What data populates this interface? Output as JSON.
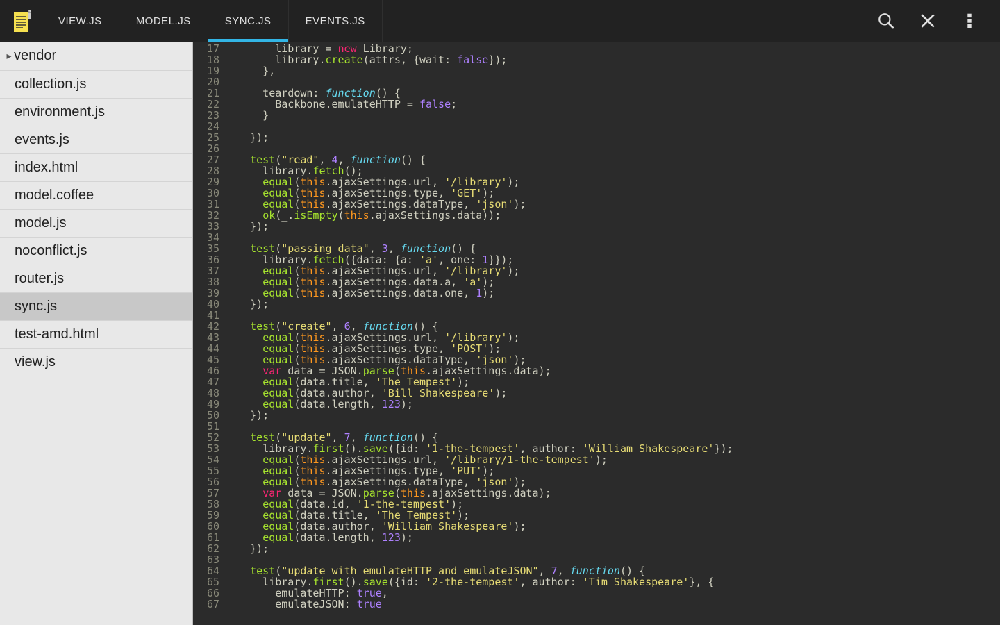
{
  "tabs": [
    {
      "label": "VIEW.JS",
      "active": false
    },
    {
      "label": "MODEL.JS",
      "active": false
    },
    {
      "label": "SYNC.JS",
      "active": true
    },
    {
      "label": "EVENTS.JS",
      "active": false
    }
  ],
  "sidebar": {
    "folder": "vendor",
    "files": [
      {
        "name": "collection.js",
        "selected": false
      },
      {
        "name": "environment.js",
        "selected": false
      },
      {
        "name": "events.js",
        "selected": false
      },
      {
        "name": "index.html",
        "selected": false
      },
      {
        "name": "model.coffee",
        "selected": false
      },
      {
        "name": "model.js",
        "selected": false
      },
      {
        "name": "noconflict.js",
        "selected": false
      },
      {
        "name": "router.js",
        "selected": false
      },
      {
        "name": "sync.js",
        "selected": true
      },
      {
        "name": "test-amd.html",
        "selected": false
      },
      {
        "name": "view.js",
        "selected": false
      }
    ]
  },
  "editor": {
    "firstLine": 17,
    "lines": [
      {
        "t": "        library = ",
        "s": [
          {
            "c": "tk-kw",
            "t": "new"
          },
          {
            "t": " Library;"
          }
        ]
      },
      {
        "t": "        library.",
        "s": [
          {
            "c": "tk-call",
            "t": "create"
          },
          {
            "t": "(attrs, {wait: "
          },
          {
            "c": "tk-bool",
            "t": "false"
          },
          {
            "t": "});"
          }
        ]
      },
      {
        "t": "      },"
      },
      {
        "t": ""
      },
      {
        "t": "      teardown: ",
        "s": [
          {
            "c": "tk-fn",
            "t": "function"
          },
          {
            "t": "() {"
          }
        ]
      },
      {
        "t": "        Backbone.emulateHTTP = ",
        "s": [
          {
            "c": "tk-bool",
            "t": "false"
          },
          {
            "t": ";"
          }
        ]
      },
      {
        "t": "      }"
      },
      {
        "t": ""
      },
      {
        "t": "    });"
      },
      {
        "t": ""
      },
      {
        "t": "    ",
        "s": [
          {
            "c": "tk-call",
            "t": "test"
          },
          {
            "t": "("
          },
          {
            "c": "tk-str",
            "t": "\"read\""
          },
          {
            "t": ", "
          },
          {
            "c": "tk-num",
            "t": "4"
          },
          {
            "t": ", "
          },
          {
            "c": "tk-fn",
            "t": "function"
          },
          {
            "t": "() {"
          }
        ]
      },
      {
        "t": "      library.",
        "s": [
          {
            "c": "tk-call",
            "t": "fetch"
          },
          {
            "t": "();"
          }
        ]
      },
      {
        "t": "      ",
        "s": [
          {
            "c": "tk-call",
            "t": "equal"
          },
          {
            "t": "("
          },
          {
            "c": "tk-this",
            "t": "this"
          },
          {
            "t": ".ajaxSettings.url, "
          },
          {
            "c": "tk-str",
            "t": "'/library'"
          },
          {
            "t": ");"
          }
        ]
      },
      {
        "t": "      ",
        "s": [
          {
            "c": "tk-call",
            "t": "equal"
          },
          {
            "t": "("
          },
          {
            "c": "tk-this",
            "t": "this"
          },
          {
            "t": ".ajaxSettings.type, "
          },
          {
            "c": "tk-str",
            "t": "'GET'"
          },
          {
            "t": ");"
          }
        ]
      },
      {
        "t": "      ",
        "s": [
          {
            "c": "tk-call",
            "t": "equal"
          },
          {
            "t": "("
          },
          {
            "c": "tk-this",
            "t": "this"
          },
          {
            "t": ".ajaxSettings.dataType, "
          },
          {
            "c": "tk-str",
            "t": "'json'"
          },
          {
            "t": ");"
          }
        ]
      },
      {
        "t": "      ",
        "s": [
          {
            "c": "tk-call",
            "t": "ok"
          },
          {
            "t": "(_."
          },
          {
            "c": "tk-call",
            "t": "isEmpty"
          },
          {
            "t": "("
          },
          {
            "c": "tk-this",
            "t": "this"
          },
          {
            "t": ".ajaxSettings.data));"
          }
        ]
      },
      {
        "t": "    });"
      },
      {
        "t": ""
      },
      {
        "t": "    ",
        "s": [
          {
            "c": "tk-call",
            "t": "test"
          },
          {
            "t": "("
          },
          {
            "c": "tk-str",
            "t": "\"passing data\""
          },
          {
            "t": ", "
          },
          {
            "c": "tk-num",
            "t": "3"
          },
          {
            "t": ", "
          },
          {
            "c": "tk-fn",
            "t": "function"
          },
          {
            "t": "() {"
          }
        ]
      },
      {
        "t": "      library.",
        "s": [
          {
            "c": "tk-call",
            "t": "fetch"
          },
          {
            "t": "({data: {a: "
          },
          {
            "c": "tk-str",
            "t": "'a'"
          },
          {
            "t": ", one: "
          },
          {
            "c": "tk-num",
            "t": "1"
          },
          {
            "t": "}});"
          }
        ]
      },
      {
        "t": "      ",
        "s": [
          {
            "c": "tk-call",
            "t": "equal"
          },
          {
            "t": "("
          },
          {
            "c": "tk-this",
            "t": "this"
          },
          {
            "t": ".ajaxSettings.url, "
          },
          {
            "c": "tk-str",
            "t": "'/library'"
          },
          {
            "t": ");"
          }
        ]
      },
      {
        "t": "      ",
        "s": [
          {
            "c": "tk-call",
            "t": "equal"
          },
          {
            "t": "("
          },
          {
            "c": "tk-this",
            "t": "this"
          },
          {
            "t": ".ajaxSettings.data.a, "
          },
          {
            "c": "tk-str",
            "t": "'a'"
          },
          {
            "t": ");"
          }
        ]
      },
      {
        "t": "      ",
        "s": [
          {
            "c": "tk-call",
            "t": "equal"
          },
          {
            "t": "("
          },
          {
            "c": "tk-this",
            "t": "this"
          },
          {
            "t": ".ajaxSettings.data.one, "
          },
          {
            "c": "tk-num",
            "t": "1"
          },
          {
            "t": ");"
          }
        ]
      },
      {
        "t": "    });"
      },
      {
        "t": ""
      },
      {
        "t": "    ",
        "s": [
          {
            "c": "tk-call",
            "t": "test"
          },
          {
            "t": "("
          },
          {
            "c": "tk-str",
            "t": "\"create\""
          },
          {
            "t": ", "
          },
          {
            "c": "tk-num",
            "t": "6"
          },
          {
            "t": ", "
          },
          {
            "c": "tk-fn",
            "t": "function"
          },
          {
            "t": "() {"
          }
        ]
      },
      {
        "t": "      ",
        "s": [
          {
            "c": "tk-call",
            "t": "equal"
          },
          {
            "t": "("
          },
          {
            "c": "tk-this",
            "t": "this"
          },
          {
            "t": ".ajaxSettings.url, "
          },
          {
            "c": "tk-str",
            "t": "'/library'"
          },
          {
            "t": ");"
          }
        ]
      },
      {
        "t": "      ",
        "s": [
          {
            "c": "tk-call",
            "t": "equal"
          },
          {
            "t": "("
          },
          {
            "c": "tk-this",
            "t": "this"
          },
          {
            "t": ".ajaxSettings.type, "
          },
          {
            "c": "tk-str",
            "t": "'POST'"
          },
          {
            "t": ");"
          }
        ]
      },
      {
        "t": "      ",
        "s": [
          {
            "c": "tk-call",
            "t": "equal"
          },
          {
            "t": "("
          },
          {
            "c": "tk-this",
            "t": "this"
          },
          {
            "t": ".ajaxSettings.dataType, "
          },
          {
            "c": "tk-str",
            "t": "'json'"
          },
          {
            "t": ");"
          }
        ]
      },
      {
        "t": "      ",
        "s": [
          {
            "c": "tk-kw",
            "t": "var"
          },
          {
            "t": " data = JSON."
          },
          {
            "c": "tk-call",
            "t": "parse"
          },
          {
            "t": "("
          },
          {
            "c": "tk-this",
            "t": "this"
          },
          {
            "t": ".ajaxSettings.data);"
          }
        ]
      },
      {
        "t": "      ",
        "s": [
          {
            "c": "tk-call",
            "t": "equal"
          },
          {
            "t": "(data.title, "
          },
          {
            "c": "tk-str",
            "t": "'The Tempest'"
          },
          {
            "t": ");"
          }
        ]
      },
      {
        "t": "      ",
        "s": [
          {
            "c": "tk-call",
            "t": "equal"
          },
          {
            "t": "(data.author, "
          },
          {
            "c": "tk-str",
            "t": "'Bill Shakespeare'"
          },
          {
            "t": ");"
          }
        ]
      },
      {
        "t": "      ",
        "s": [
          {
            "c": "tk-call",
            "t": "equal"
          },
          {
            "t": "(data.length, "
          },
          {
            "c": "tk-num",
            "t": "123"
          },
          {
            "t": ");"
          }
        ]
      },
      {
        "t": "    });"
      },
      {
        "t": ""
      },
      {
        "t": "    ",
        "s": [
          {
            "c": "tk-call",
            "t": "test"
          },
          {
            "t": "("
          },
          {
            "c": "tk-str",
            "t": "\"update\""
          },
          {
            "t": ", "
          },
          {
            "c": "tk-num",
            "t": "7"
          },
          {
            "t": ", "
          },
          {
            "c": "tk-fn",
            "t": "function"
          },
          {
            "t": "() {"
          }
        ]
      },
      {
        "t": "      library.",
        "s": [
          {
            "c": "tk-call",
            "t": "first"
          },
          {
            "t": "()."
          },
          {
            "c": "tk-call",
            "t": "save"
          },
          {
            "t": "({id: "
          },
          {
            "c": "tk-str",
            "t": "'1-the-tempest'"
          },
          {
            "t": ", author: "
          },
          {
            "c": "tk-str",
            "t": "'William Shakespeare'"
          },
          {
            "t": "});"
          }
        ]
      },
      {
        "t": "      ",
        "s": [
          {
            "c": "tk-call",
            "t": "equal"
          },
          {
            "t": "("
          },
          {
            "c": "tk-this",
            "t": "this"
          },
          {
            "t": ".ajaxSettings.url, "
          },
          {
            "c": "tk-str",
            "t": "'/library/1-the-tempest'"
          },
          {
            "t": ");"
          }
        ]
      },
      {
        "t": "      ",
        "s": [
          {
            "c": "tk-call",
            "t": "equal"
          },
          {
            "t": "("
          },
          {
            "c": "tk-this",
            "t": "this"
          },
          {
            "t": ".ajaxSettings.type, "
          },
          {
            "c": "tk-str",
            "t": "'PUT'"
          },
          {
            "t": ");"
          }
        ]
      },
      {
        "t": "      ",
        "s": [
          {
            "c": "tk-call",
            "t": "equal"
          },
          {
            "t": "("
          },
          {
            "c": "tk-this",
            "t": "this"
          },
          {
            "t": ".ajaxSettings.dataType, "
          },
          {
            "c": "tk-str",
            "t": "'json'"
          },
          {
            "t": ");"
          }
        ]
      },
      {
        "t": "      ",
        "s": [
          {
            "c": "tk-kw",
            "t": "var"
          },
          {
            "t": " data = JSON."
          },
          {
            "c": "tk-call",
            "t": "parse"
          },
          {
            "t": "("
          },
          {
            "c": "tk-this",
            "t": "this"
          },
          {
            "t": ".ajaxSettings.data);"
          }
        ]
      },
      {
        "t": "      ",
        "s": [
          {
            "c": "tk-call",
            "t": "equal"
          },
          {
            "t": "(data.id, "
          },
          {
            "c": "tk-str",
            "t": "'1-the-tempest'"
          },
          {
            "t": ");"
          }
        ]
      },
      {
        "t": "      ",
        "s": [
          {
            "c": "tk-call",
            "t": "equal"
          },
          {
            "t": "(data.title, "
          },
          {
            "c": "tk-str",
            "t": "'The Tempest'"
          },
          {
            "t": ");"
          }
        ]
      },
      {
        "t": "      ",
        "s": [
          {
            "c": "tk-call",
            "t": "equal"
          },
          {
            "t": "(data.author, "
          },
          {
            "c": "tk-str",
            "t": "'William Shakespeare'"
          },
          {
            "t": ");"
          }
        ]
      },
      {
        "t": "      ",
        "s": [
          {
            "c": "tk-call",
            "t": "equal"
          },
          {
            "t": "(data.length, "
          },
          {
            "c": "tk-num",
            "t": "123"
          },
          {
            "t": ");"
          }
        ]
      },
      {
        "t": "    });"
      },
      {
        "t": ""
      },
      {
        "t": "    ",
        "s": [
          {
            "c": "tk-call",
            "t": "test"
          },
          {
            "t": "("
          },
          {
            "c": "tk-str",
            "t": "\"update with emulateHTTP and emulateJSON\""
          },
          {
            "t": ", "
          },
          {
            "c": "tk-num",
            "t": "7"
          },
          {
            "t": ", "
          },
          {
            "c": "tk-fn",
            "t": "function"
          },
          {
            "t": "() {"
          }
        ]
      },
      {
        "t": "      library.",
        "s": [
          {
            "c": "tk-call",
            "t": "first"
          },
          {
            "t": "()."
          },
          {
            "c": "tk-call",
            "t": "save"
          },
          {
            "t": "({id: "
          },
          {
            "c": "tk-str",
            "t": "'2-the-tempest'"
          },
          {
            "t": ", author: "
          },
          {
            "c": "tk-str",
            "t": "'Tim Shakespeare'"
          },
          {
            "t": "}, {"
          }
        ]
      },
      {
        "t": "        emulateHTTP: ",
        "s": [
          {
            "c": "tk-bool",
            "t": "true"
          },
          {
            "t": ","
          }
        ]
      },
      {
        "t": "        emulateJSON: ",
        "s": [
          {
            "c": "tk-bool",
            "t": "true"
          }
        ]
      }
    ]
  }
}
